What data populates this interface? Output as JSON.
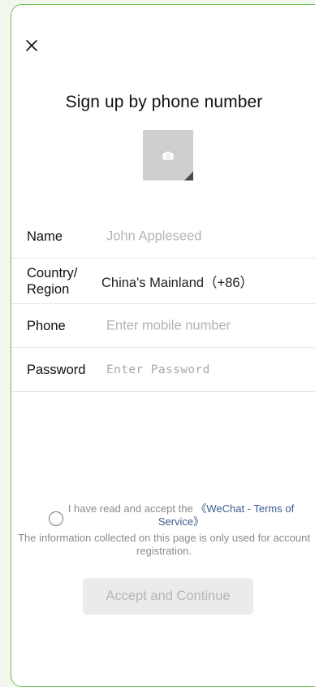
{
  "header": {
    "close_icon": "close-icon",
    "title": "Sign up by phone number"
  },
  "avatar": {
    "icon": "camera-icon"
  },
  "form": {
    "name": {
      "label": "Name",
      "placeholder": "John Appleseed",
      "value": ""
    },
    "country": {
      "label_line1": "Country/",
      "label_line2": "Region",
      "value": "China's Mainland（+86）"
    },
    "phone": {
      "label": "Phone",
      "placeholder": "Enter mobile number",
      "value": ""
    },
    "password": {
      "label": "Password",
      "placeholder": "Enter Password",
      "value": ""
    }
  },
  "agreement": {
    "checked": false,
    "prefix": "I have read and accept the ",
    "terms_link": "《WeChat - Terms of Service》",
    "info": "The information collected on this page is only used for account registration."
  },
  "actions": {
    "continue_label": "Accept and Continue",
    "enabled": false
  },
  "colors": {
    "frame_border": "#69c44d",
    "link": "#3b5b8c",
    "button_disabled_bg": "#ebebeb",
    "button_disabled_text": "#b5b5b5"
  }
}
